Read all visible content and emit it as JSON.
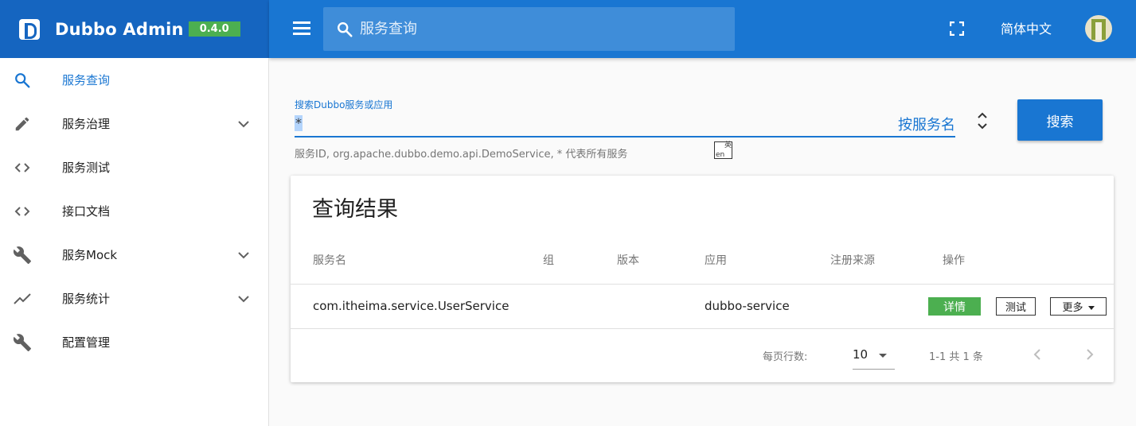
{
  "brand": {
    "title": "Dubbo Admin",
    "version": "0.4.0"
  },
  "topbar": {
    "search_placeholder": "服务查询",
    "language": "简体中文"
  },
  "sidebar": {
    "items": [
      {
        "label": "服务查询",
        "icon": "search-icon",
        "active": true,
        "expandable": false
      },
      {
        "label": "服务治理",
        "icon": "pencil-icon",
        "active": false,
        "expandable": true
      },
      {
        "label": "服务测试",
        "icon": "code-icon",
        "active": false,
        "expandable": false
      },
      {
        "label": "接口文档",
        "icon": "code-icon",
        "active": false,
        "expandable": false
      },
      {
        "label": "服务Mock",
        "icon": "wrench-icon",
        "active": false,
        "expandable": true
      },
      {
        "label": "服务统计",
        "icon": "trending-icon",
        "active": false,
        "expandable": true
      },
      {
        "label": "配置管理",
        "icon": "wrench-icon",
        "active": false,
        "expandable": false
      }
    ]
  },
  "search": {
    "label": "搜索Dubbo服务或应用",
    "value": "*",
    "type": "按服务名",
    "hint": "服务ID, org.apache.dubbo.demo.api.DemoService, * 代表所有服务",
    "button": "搜索"
  },
  "ime": {
    "top": "英",
    "bottom": "en"
  },
  "results": {
    "title": "查询结果",
    "headers": [
      "服务名",
      "组",
      "版本",
      "应用",
      "注册来源",
      "操作"
    ],
    "rows": [
      {
        "service": "com.itheima.service.UserService",
        "group": "",
        "version": "",
        "application": "dubbo-service",
        "source": ""
      }
    ],
    "actions": {
      "detail": "详情",
      "test": "测试",
      "more": "更多"
    },
    "pagination": {
      "rows_per_page_label": "每页行数:",
      "rows_per_page": "10",
      "range": "1-1 共 1 条"
    }
  },
  "colors": {
    "primary": "#1976d2",
    "brand_bar": "#1565c0",
    "success": "#4caf50"
  }
}
